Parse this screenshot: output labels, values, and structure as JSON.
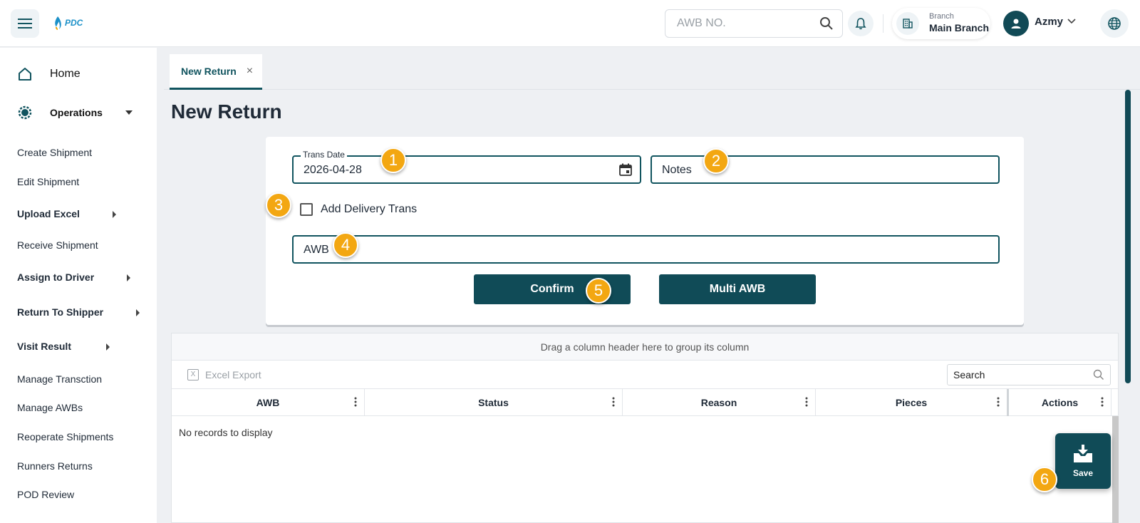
{
  "header": {
    "logo_text": "PDC",
    "awb_search_placeholder": "AWB NO.",
    "branch_caption": "Branch",
    "branch_name": "Main Branch",
    "user_name": "Azmy"
  },
  "sidebar": {
    "home_label": "Home",
    "operations_label": "Operations",
    "items": [
      {
        "label": "Create Shipment",
        "bold": false,
        "submenu": false
      },
      {
        "label": "Edit Shipment",
        "bold": false,
        "submenu": false
      },
      {
        "label": "Upload Excel",
        "bold": true,
        "submenu": true
      },
      {
        "label": "Receive Shipment",
        "bold": false,
        "submenu": false
      },
      {
        "label": "Assign to Driver",
        "bold": true,
        "submenu": true
      },
      {
        "label": "Return To Shipper",
        "bold": true,
        "submenu": true
      },
      {
        "label": "Visit Result",
        "bold": true,
        "submenu": true
      },
      {
        "label": "Manage Transction",
        "bold": false,
        "submenu": false
      },
      {
        "label": "Manage AWBs",
        "bold": false,
        "submenu": false
      },
      {
        "label": "Reoperate Shipments",
        "bold": false,
        "submenu": false
      },
      {
        "label": "Runners Returns",
        "bold": false,
        "submenu": false
      },
      {
        "label": "POD Review",
        "bold": false,
        "submenu": false
      }
    ]
  },
  "tabs": [
    {
      "label": "New Return",
      "close": "×"
    }
  ],
  "page_title": "New Return",
  "form": {
    "trans_date_label": "Trans Date",
    "trans_date_value": "2026-04-28",
    "notes_label": "Notes",
    "add_delivery_label": "Add Delivery Trans",
    "add_delivery_checked": false,
    "awb_label": "AWB",
    "confirm_label": "Confirm",
    "multi_awb_label": "Multi AWB"
  },
  "grid": {
    "group_hint": "Drag a column header here to group its column",
    "excel_export_label": "Excel Export",
    "search_placeholder": "Search",
    "columns": [
      "AWB",
      "Status",
      "Reason",
      "Pieces",
      "Actions"
    ],
    "rows": [],
    "empty_text": "No records to display"
  },
  "save_label": "Save",
  "badges": [
    "1",
    "2",
    "3",
    "4",
    "5",
    "6"
  ],
  "colors": {
    "primary": "#104b57",
    "badge": "#f3a712",
    "accent": "#11545f"
  }
}
